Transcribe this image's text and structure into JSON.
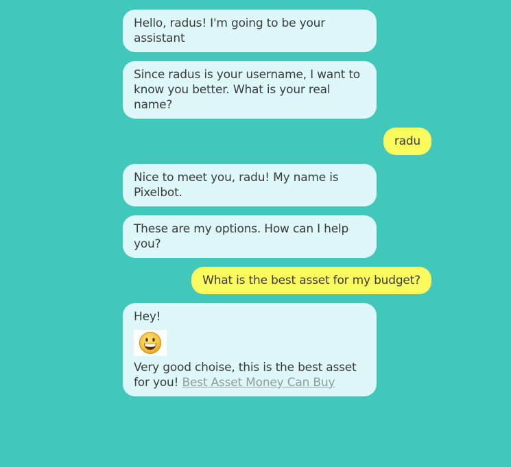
{
  "messages": [
    {
      "from": "bot",
      "text": "Hello, radus! I'm going to be your assistant"
    },
    {
      "from": "bot",
      "text": "Since radus is your username, I want to know you better. What is your real name?"
    },
    {
      "from": "user",
      "text": "radu"
    },
    {
      "from": "bot",
      "text": "Nice to meet you, radu! My name is Pixelbot."
    },
    {
      "from": "bot",
      "text": "These are my options. How can I help you?"
    },
    {
      "from": "user",
      "text": "What is the best asset for my budget?"
    },
    {
      "from": "bot",
      "greeting": "Hey!",
      "emoji": "grinning-face-emoji",
      "text": "Very good choise, this is the best asset for you!",
      "link_text": "Best Asset Money Can Buy"
    }
  ],
  "colors": {
    "background": "#41c8ba",
    "bot_bubble": "#def8f9",
    "user_bubble": "#fbfb5e",
    "link": "#8f9c9d"
  }
}
